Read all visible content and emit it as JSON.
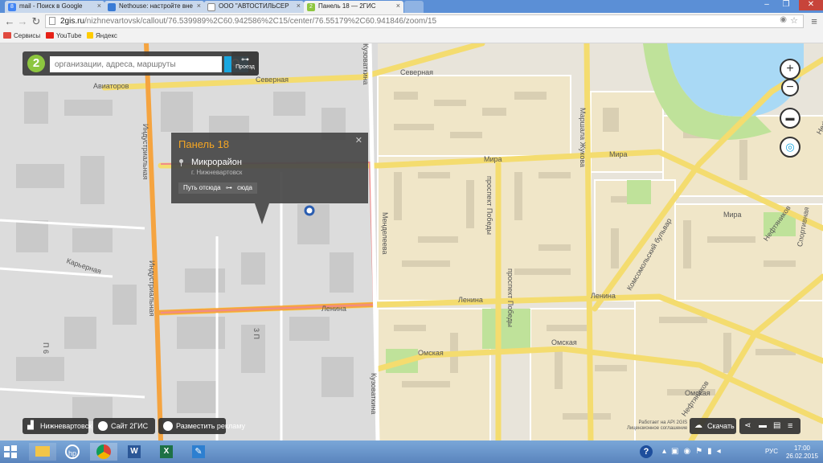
{
  "browser": {
    "tabs": [
      {
        "label": "mail - Поиск в Google",
        "icon": "google-favicon",
        "color": "#4285f4",
        "active": false
      },
      {
        "label": "Nethouse: настройте вне",
        "icon": "nethouse-favicon",
        "color": "#3a7bd5",
        "active": false
      },
      {
        "label": "ООО \"АВТОСТИЛЬСЕР",
        "icon": "page-favicon",
        "color": "#888888",
        "active": false
      },
      {
        "label": "Панель 18 — 2ГИС",
        "icon": "2gis-favicon",
        "color": "#8dc63f",
        "active": true
      }
    ],
    "url_host": "2gis.ru",
    "url_path": "/nizhnevartovsk/callout/76.539989%2C60.942586%2C15/center/76.55179%2C60.941846/zoom/15",
    "bookmarks": [
      {
        "label": "Сервисы",
        "icon": "apps-icon",
        "color": "#e04a3f"
      },
      {
        "label": "YouTube",
        "icon": "youtube-icon",
        "color": "#e62117"
      },
      {
        "label": "Яндекс",
        "icon": "yandex-icon",
        "color": "#ffcc00"
      }
    ]
  },
  "search": {
    "placeholder": "организации, адреса, маршруты",
    "route_label": "Проезд"
  },
  "popup": {
    "title": "Панель 18",
    "name": "Микрорайон",
    "city": "г. Нижневартовск",
    "route_from": "Путь отсюда",
    "route_to": "сюда"
  },
  "map_labels": {
    "severnaya_1": "Северная",
    "severnaya_2": "Северная",
    "aviatorov": "Авиаторов",
    "mira_1": "Мира",
    "mira_2": "Мира",
    "mira_3": "Мира",
    "lenina_1": "Ленина",
    "lenina_2": "Ленина",
    "lenina_3": "Ленина",
    "omskaya_1": "Омская",
    "omskaya_2": "Омская",
    "omskaya_3": "Омская",
    "karernaya": "Карьерная",
    "industrialnaya_1": "Индустриальная",
    "industrialnaya_2": "Индустриальная",
    "kuvovatkina_1": "Кузоваткина",
    "kuvovatkina_2": "Кузоваткина",
    "mendeleeva": "Менделеева",
    "pr_pobedy_1": "проспект Победы",
    "pr_pobedy_2": "проспект Победы",
    "marshala_zhukova": "Маршала Жукова",
    "komsomolsky": "Комсомольский бульвар",
    "neftyanikov_1": "Нефтяников",
    "neftyanikov_2": "Нефтяников",
    "neftyanikov_3": "Нефтяников",
    "sportivnaya": "Спортивная",
    "p6": "П 6",
    "p3": "3 П"
  },
  "bottom_bar": {
    "city_button": "Нижневартовск",
    "site_button": "Сайт 2ГИС",
    "ads_button": "Разместить рекламу",
    "download_button": "Скачать",
    "copyright_line1": "Работает на API 2GIS",
    "copyright_line2": "Лицензионное соглашение"
  },
  "taskbar": {
    "apps": [
      "windows-start-icon",
      "explorer-icon",
      "hp-icon",
      "chrome-icon",
      "word-icon",
      "excel-icon",
      "pen-icon"
    ],
    "language": "РУС",
    "time": "17:00",
    "date": "26.02.2015"
  },
  "colors": {
    "map_bg": "#ece8dd",
    "block": "#e4dcc6",
    "building": "#d5cfc0",
    "road_yellow": "#f6e27a",
    "road_orange": "#f5a440",
    "water": "#aadfff",
    "park": "#b8dd8e",
    "accent_2gis": "#8dc63f"
  }
}
